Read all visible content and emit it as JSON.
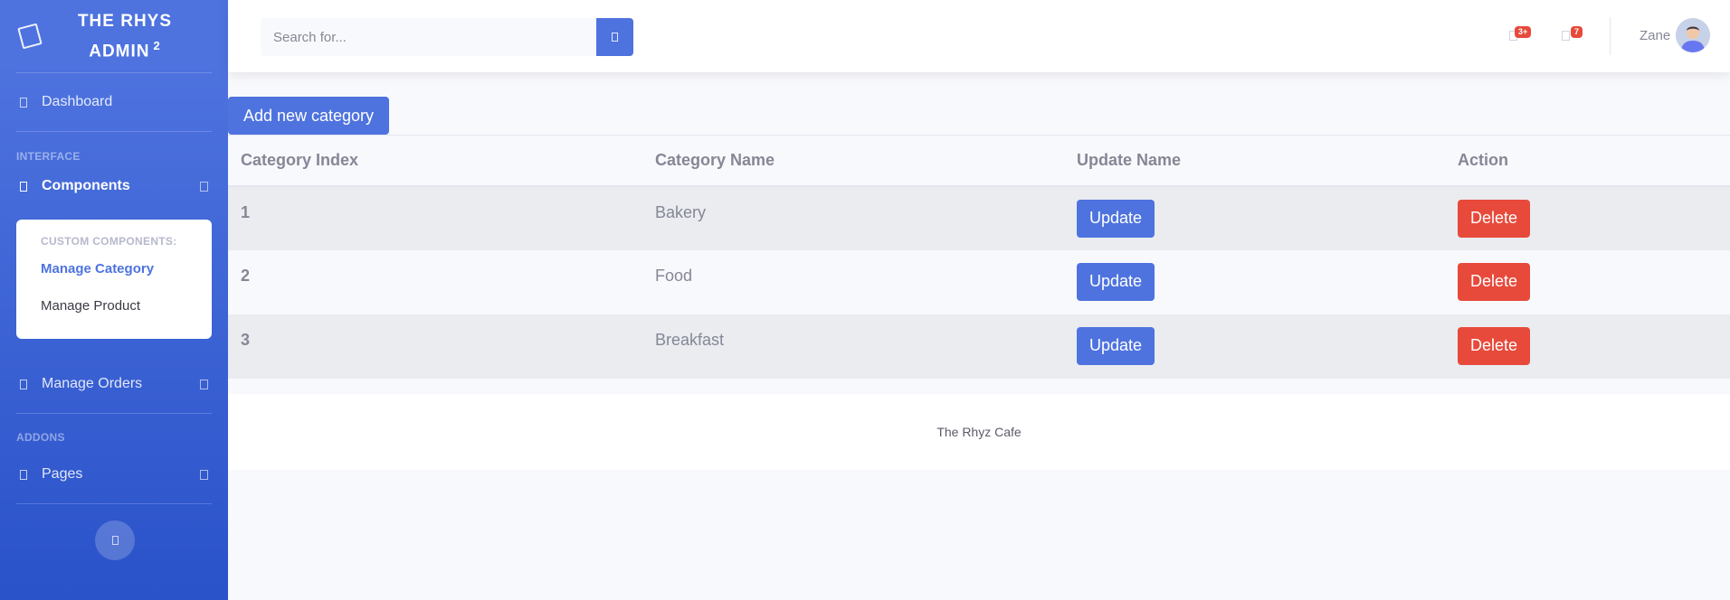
{
  "sidebar": {
    "brand": "The Rhys Admin",
    "brand_sup": "2",
    "dashboard": "Dashboard",
    "heading_interface": "Interface",
    "components": "Components",
    "collapse_header": "Custom Components:",
    "manage_category": "Manage Category",
    "manage_product": "Manage Product",
    "manage_orders": "Manage Orders",
    "heading_addons": "Addons",
    "pages": "Pages"
  },
  "topbar": {
    "search_placeholder": "Search for...",
    "alerts_badge": "3+",
    "messages_badge": "7",
    "user_name": "Zane"
  },
  "main": {
    "add_button": "Add new category",
    "columns": [
      "Category Index",
      "Category Name",
      "Update Name",
      "Action"
    ],
    "rows": [
      {
        "index": "1",
        "name": "Bakery",
        "update": "Update",
        "delete": "Delete"
      },
      {
        "index": "2",
        "name": "Food",
        "update": "Update",
        "delete": "Delete"
      },
      {
        "index": "3",
        "name": "Breakfast",
        "update": "Update",
        "delete": "Delete"
      }
    ]
  },
  "footer": {
    "text": "The Rhyz Cafe"
  },
  "colors": {
    "primary": "#4e73df",
    "danger": "#e74a3b"
  }
}
